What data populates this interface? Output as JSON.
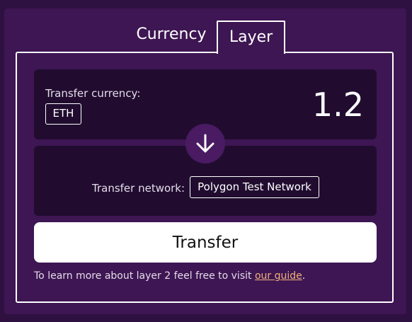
{
  "tabs": {
    "currency_label": "Currency",
    "layer_label": "Layer",
    "active": "Layer"
  },
  "transfer": {
    "currency_label": "Transfer currency:",
    "currency_value": "ETH",
    "amount": "1.2",
    "network_label": "Transfer network:",
    "network_value": "Polygon Test Network",
    "button_label": "Transfer"
  },
  "footer": {
    "text": "To learn more about layer 2 feel free to visit ",
    "link_text": "our guide",
    "suffix": "."
  },
  "icons": {
    "swap": "arrow-down-icon"
  },
  "colors": {
    "background": "#2e1140",
    "panel": "#3e1653",
    "card": "#210c30",
    "link": "#f0b27a",
    "button": "#ffffff"
  }
}
